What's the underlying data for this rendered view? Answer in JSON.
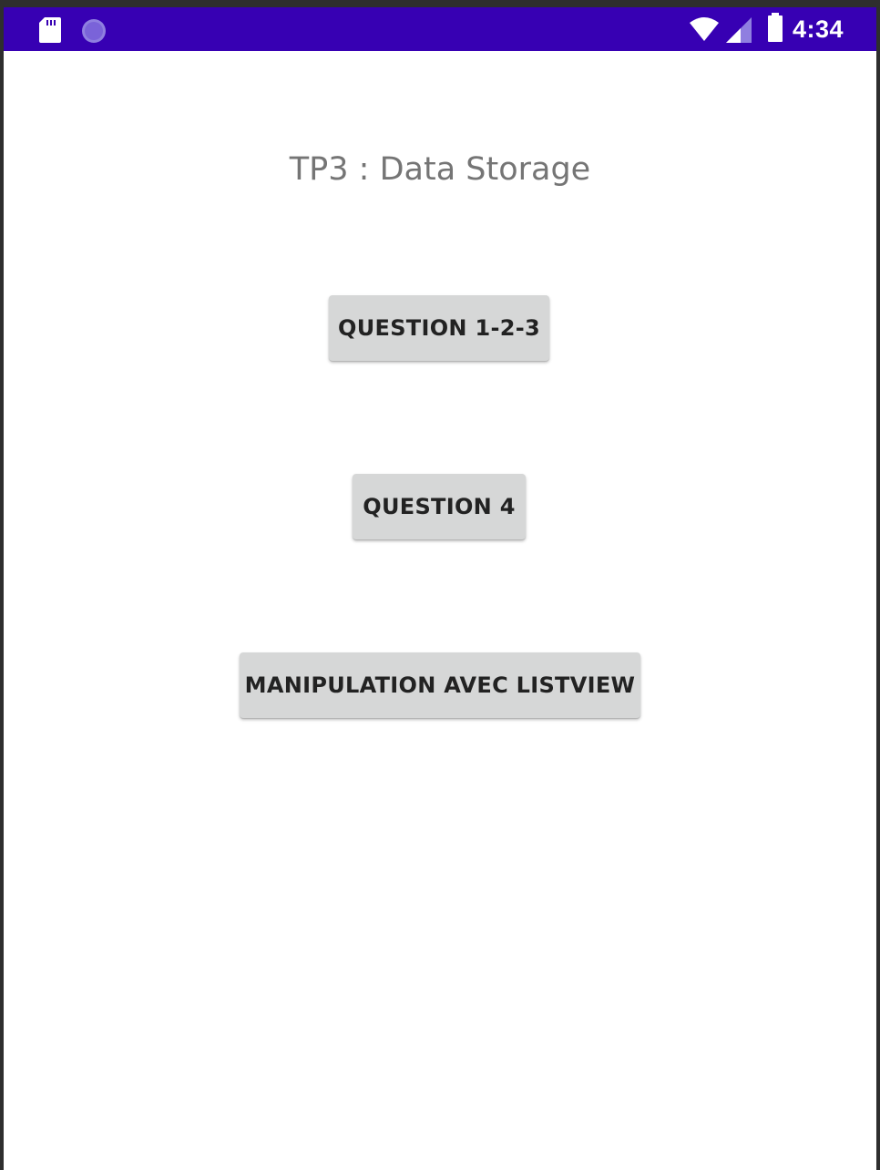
{
  "status_bar": {
    "time": "4:34",
    "background_color": "#3700b3",
    "icons": [
      "sd-card-icon",
      "circle-notification-icon",
      "wifi-icon",
      "cell-signal-icon",
      "battery-icon"
    ]
  },
  "main": {
    "title": "TP3 : Data Storage",
    "buttons": [
      {
        "label": "QUESTION 1-2-3"
      },
      {
        "label": "QUESTION 4"
      },
      {
        "label": "MANIPULATION AVEC LISTVIEW"
      }
    ]
  },
  "colors": {
    "button_background": "#d6d7d7",
    "title_text": "#757575",
    "screen_background": "#ffffff"
  }
}
